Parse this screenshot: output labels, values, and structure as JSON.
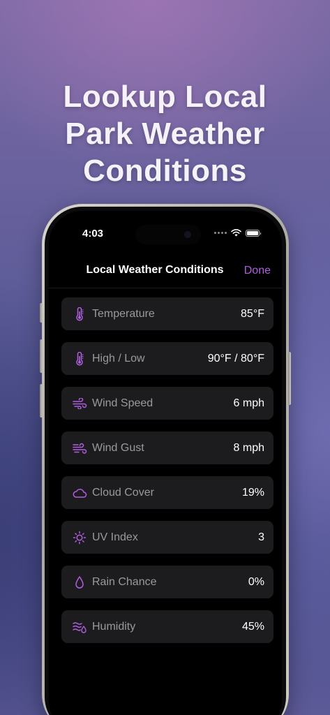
{
  "headline": {
    "line1": "Lookup Local",
    "line2": "Park Weather",
    "line3": "Conditions"
  },
  "status_bar": {
    "time": "4:03"
  },
  "nav": {
    "title": "Local Weather Conditions",
    "done_label": "Done"
  },
  "accent_color": "#b15fe0",
  "rows": [
    {
      "icon": "thermometer-icon",
      "label": "Temperature",
      "value": "85°F"
    },
    {
      "icon": "thermometer-icon",
      "label": "High / Low",
      "value": "90°F / 80°F"
    },
    {
      "icon": "wind-icon",
      "label": "Wind Speed",
      "value": "6 mph"
    },
    {
      "icon": "wind-gust-icon",
      "label": "Wind Gust",
      "value": "8 mph"
    },
    {
      "icon": "cloud-icon",
      "label": "Cloud Cover",
      "value": "19%"
    },
    {
      "icon": "sun-icon",
      "label": "UV Index",
      "value": "3"
    },
    {
      "icon": "raindrop-icon",
      "label": "Rain Chance",
      "value": "0%"
    },
    {
      "icon": "humidity-icon",
      "label": "Humidity",
      "value": "45%"
    }
  ]
}
